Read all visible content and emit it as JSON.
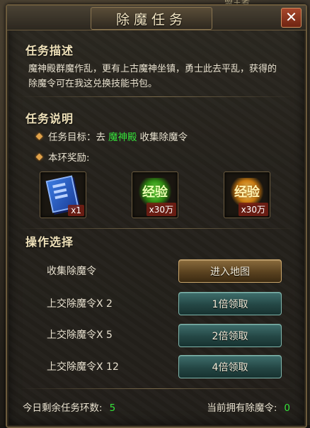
{
  "window": {
    "title": "除魔任务",
    "close_label": "✕"
  },
  "top_peek_text": "盟主者",
  "description": {
    "heading": "任务描述",
    "text": "魔神殿群魔作乱，更有上古魔神坐镇，勇士此去平乱，获得的除魔令可在我这兑换技能书包。"
  },
  "instructions": {
    "heading": "任务说明",
    "goal_prefix": "任务目标：去",
    "goal_location": "魔神殿",
    "goal_suffix": "收集除魔令",
    "reward_label": "本环奖励:",
    "rewards": [
      {
        "icon": "skill-book-icon",
        "qty": "x1"
      },
      {
        "icon": "experience-green-icon",
        "label": "经验",
        "qty": "x30万"
      },
      {
        "icon": "experience-gold-icon",
        "label": "经验",
        "qty": "x30万"
      }
    ]
  },
  "operations": {
    "heading": "操作选择",
    "rows": [
      {
        "label": "收集除魔令",
        "button": "进入地图",
        "style": "gold"
      },
      {
        "label": "上交除魔令X 2",
        "button": "1倍领取",
        "style": "teal"
      },
      {
        "label": "上交除魔令X 5",
        "button": "2倍领取",
        "style": "teal"
      },
      {
        "label": "上交除魔令X 12",
        "button": "4倍领取",
        "style": "teal"
      }
    ]
  },
  "footer": {
    "remaining_label": "今日剩余任务环数:",
    "remaining_value": "5",
    "owned_label": "当前拥有除魔令:",
    "owned_value": "0"
  },
  "colors": {
    "accent_green": "#35e23a",
    "frame_gold": "#6b5a3c",
    "close_red": "#a8472c"
  }
}
